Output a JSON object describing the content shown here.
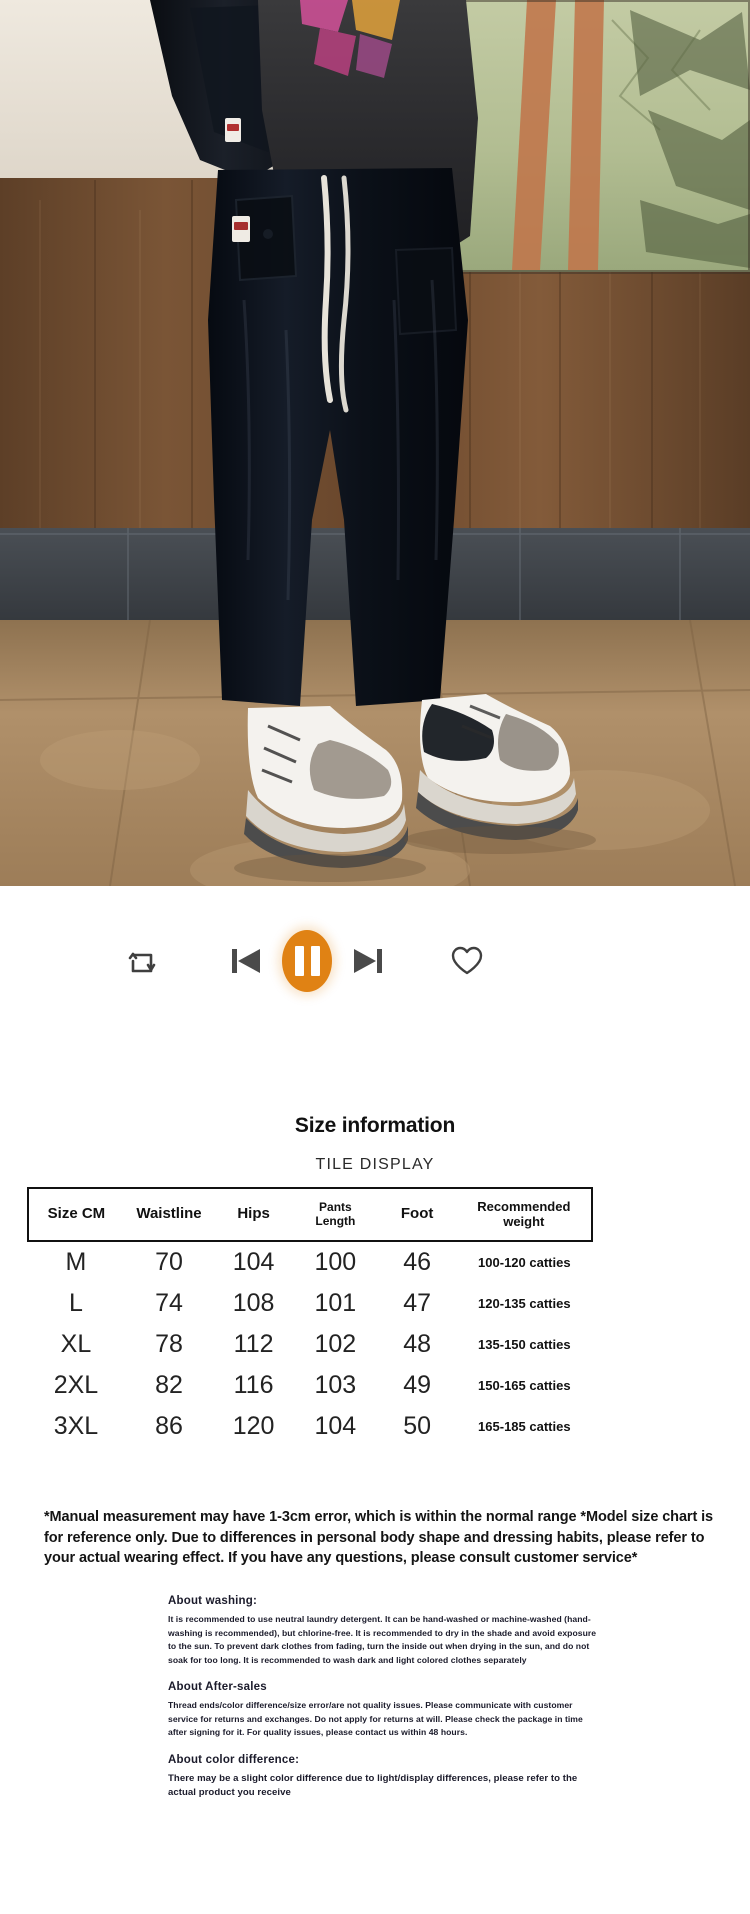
{
  "photo": {
    "alt": "model-wearing-black-cargo-pants-and-black-jacket-indoors",
    "colors": {
      "wall_upper": "#e8e2d8",
      "wood_panel": "#6b4a2f",
      "stone_band": "#3f4449",
      "floor": "#a98a63",
      "garment_black": "#0d1118",
      "artwork_green": "#b9c49a",
      "artwork_orange": "#c9764a",
      "shoe_white": "#f2f0ec",
      "shoe_grey": "#9b948c"
    }
  },
  "player": {
    "repeat_icon": "repeat-icon",
    "previous_icon": "previous-track-icon",
    "play_pause_icon": "pause-icon",
    "next_icon": "next-track-icon",
    "favorite_icon": "heart-icon",
    "accent_color": "#e08214",
    "icon_color": "#4a4a4a"
  },
  "size_section": {
    "title": "Size information",
    "subtitle": "TILE DISPLAY"
  },
  "chart_data": {
    "type": "table",
    "title": "Size information",
    "columns": [
      "Size CM",
      "Waistline",
      "Hips",
      "Pants\nLength",
      "Foot",
      "Recommended weight"
    ],
    "column_labels": {
      "size": "Size CM",
      "waistline": "Waistline",
      "hips": "Hips",
      "pants_length_line1": "Pants",
      "pants_length_line2": "Length",
      "foot": "Foot",
      "weight": "Recommended weight"
    },
    "rows": [
      {
        "size": "M",
        "waistline": "70",
        "hips": "104",
        "pants_length": "100",
        "foot": "46",
        "weight": "100-120 catties"
      },
      {
        "size": "L",
        "waistline": "74",
        "hips": "108",
        "pants_length": "101",
        "foot": "47",
        "weight": "120-135 catties"
      },
      {
        "size": "XL",
        "waistline": "78",
        "hips": "112",
        "pants_length": "102",
        "foot": "48",
        "weight": "135-150 catties"
      },
      {
        "size": "2XL",
        "waistline": "82",
        "hips": "116",
        "pants_length": "103",
        "foot": "49",
        "weight": "150-165 catties"
      },
      {
        "size": "3XL",
        "waistline": "86",
        "hips": "120",
        "pants_length": "104",
        "foot": "50",
        "weight": "165-185 catties"
      }
    ]
  },
  "disclaimer": "*Manual measurement may have 1-3cm error, which is within the normal range *Model size chart is for reference only. Due to differences in personal body shape and dressing habits, please refer to your actual wearing effect. If you have any questions, please consult customer service*",
  "care": {
    "washing_heading": "About washing:",
    "washing_body": "It is recommended to use neutral laundry detergent. It can be hand-washed or machine-washed (hand-washing is recommended), but chlorine-free. It is recommended to dry in the shade and avoid exposure to the sun. To prevent dark clothes from fading, turn the inside out when drying in the sun, and do not soak for too long. It is recommended to wash dark and light colored clothes separately",
    "aftersales_heading": "About After-sales",
    "aftersales_body": "Thread ends/color difference/size error/are not quality issues. Please communicate with customer service for returns and exchanges. Do not apply for returns at will. Please check the package in time after signing for it. For quality issues, please contact us within 48 hours.",
    "color_heading": "About color difference:",
    "color_body": "There may be a slight color difference due to light/display differences, please refer to the actual product you receive"
  }
}
